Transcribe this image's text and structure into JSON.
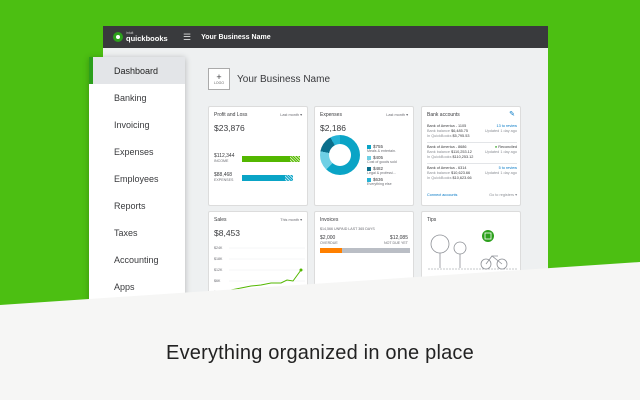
{
  "app": {
    "logo_top": "intuit",
    "logo_name": "quickbooks",
    "business_name": "Your Business Name"
  },
  "header": {
    "logo_label": "LOGO",
    "title": "Your Business Name"
  },
  "sidebar": {
    "items": [
      {
        "label": "Dashboard",
        "active": true
      },
      {
        "label": "Banking"
      },
      {
        "label": "Invoicing"
      },
      {
        "label": "Expenses"
      },
      {
        "label": "Employees"
      },
      {
        "label": "Reports"
      },
      {
        "label": "Taxes"
      },
      {
        "label": "Accounting"
      },
      {
        "label": "Apps"
      }
    ]
  },
  "cards": {
    "profit_loss": {
      "title": "Profit and Loss",
      "period": "Last month ▾",
      "total": "$23,876",
      "income_value": "$112,344",
      "income_label": "INCOME",
      "income_fraction": 0.9,
      "expenses_value": "$88,468",
      "expenses_label": "EXPENSES",
      "expenses_fraction": 0.75
    },
    "expenses": {
      "title": "Expenses",
      "period": "Last month ▾",
      "total": "$2,186",
      "legend": [
        {
          "value": "$755",
          "label": "Meals & entertain."
        },
        {
          "value": "$405",
          "label": "Cost of goods sold"
        },
        {
          "value": "$482",
          "label": "Legal & professi..."
        },
        {
          "value": "$636",
          "label": "Everything else"
        }
      ]
    },
    "bank": {
      "title": "Bank accounts",
      "edit_icon": "pencil-icon",
      "accounts": [
        {
          "name": "Bank of America - 1105",
          "bank_label": "Bank balance",
          "bank_value": "$6,485.75",
          "qb_label": "In QuickBooks",
          "qb_value": "$5,795.53",
          "status": "13 to review",
          "status_sub": "Updated 1 day ago"
        },
        {
          "name": "Bank of America - 8686",
          "bank_label": "Bank balance",
          "bank_value": "$110,253.12",
          "qb_label": "In QuickBooks",
          "qb_value": "$110,253.12",
          "status": "Reconciled",
          "status_sub": "Updated 1 day ago"
        },
        {
          "name": "Bank of America - 6314",
          "bank_label": "Bank balance",
          "bank_value": "$10,623.66",
          "qb_label": "In QuickBooks",
          "qb_value": "$10,623.66",
          "status": "5 to review",
          "status_sub": "Updated 1 day ago"
        }
      ],
      "connect": "Connect accounts",
      "register": "Go to registers ▾"
    },
    "sales": {
      "title": "Sales",
      "period": "This month ▾",
      "total": "$8,453",
      "y_ticks": [
        "$24K",
        "$18K",
        "$12K",
        "$6K",
        "$0"
      ]
    },
    "invoices": {
      "title": "Invoices",
      "unpaid": "$14,566 UNPAID LAST 365 DAYS",
      "overdue_value": "$2,000",
      "overdue_label": "OVERDUE",
      "not_due_value": "$12,085",
      "not_due_label": "NOT DUE YET"
    },
    "tips": {
      "title": "Tips"
    }
  },
  "tagline": "Everything organized in one place",
  "colors": {
    "green": "#4cbf12",
    "qb_green": "#2ca01c",
    "teal": "#0aa4c6",
    "topbar": "#393a3d"
  }
}
